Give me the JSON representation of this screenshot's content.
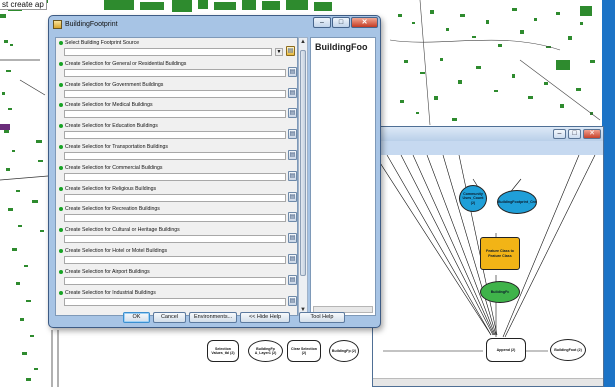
{
  "note_text": "st create ap",
  "dialog": {
    "title": "BuildingFootprint",
    "params": [
      {
        "label": "Select Building Footprint Source"
      },
      {
        "label": "Create Selection for General or Residential Buildings"
      },
      {
        "label": "Create Selection for Government Buildings"
      },
      {
        "label": "Create Selection for Medical Buildings"
      },
      {
        "label": "Create Selection for Education Buildings"
      },
      {
        "label": "Create Selection for Transportation Buildings"
      },
      {
        "label": "Create Selection for Commercial Buildings"
      },
      {
        "label": "Create Selection for Religious Buildings"
      },
      {
        "label": "Create Selection for Recreation Buildings"
      },
      {
        "label": "Create Selection for Cultural or Heritage Buildings"
      },
      {
        "label": "Create Selection for Hotel or Motel Buildings"
      },
      {
        "label": "Create Selection for Airport Buildings"
      },
      {
        "label": "Create Selection for Industrial Buildings"
      }
    ],
    "help_title": "BuildingFoo",
    "buttons": {
      "ok": "OK",
      "cancel": "Cancel",
      "environments": "Environments...",
      "hide_help": "<< Hide Help",
      "tool_help": "Tool Help"
    }
  },
  "model": {
    "nodes": [
      {
        "id": "in1",
        "label": "Community Uses_Count (2)",
        "shape": "ellipse",
        "color": "#1f9fd8"
      },
      {
        "id": "in2",
        "label": "BuildingFootprint_Cnt",
        "shape": "ellipse",
        "color": "#1f9fd8"
      },
      {
        "id": "tool1",
        "label": "Feature Class to Feature Class",
        "shape": "rect",
        "color": "#f2b416"
      },
      {
        "id": "out1",
        "label": "BuildingFc",
        "shape": "ellipse",
        "color": "#3fb34a"
      },
      {
        "id": "n5",
        "label": "Selection Values_tbl (2)",
        "shape": "rect",
        "color": "#ffffff"
      },
      {
        "id": "n6",
        "label": "BuildingFp A_Layer1 (2)",
        "shape": "ellipse",
        "color": "#ffffff"
      },
      {
        "id": "n7",
        "label": "Clear Selection (2)",
        "shape": "rect",
        "color": "#ffffff"
      },
      {
        "id": "n8",
        "label": "BuildingFp (2)",
        "shape": "ellipse",
        "color": "#ffffff"
      },
      {
        "id": "n9",
        "label": "Append (2)",
        "shape": "rect",
        "color": "#ffffff"
      },
      {
        "id": "n10",
        "label": "BuildingFoot (2)",
        "shape": "ellipse",
        "color": "#ffffff"
      }
    ]
  },
  "colors": {
    "desktop": "#1b6ec0",
    "map_green": "#2e8b2e",
    "dialog_frame": "#a7c4e5",
    "required_dot": "#17a325"
  }
}
